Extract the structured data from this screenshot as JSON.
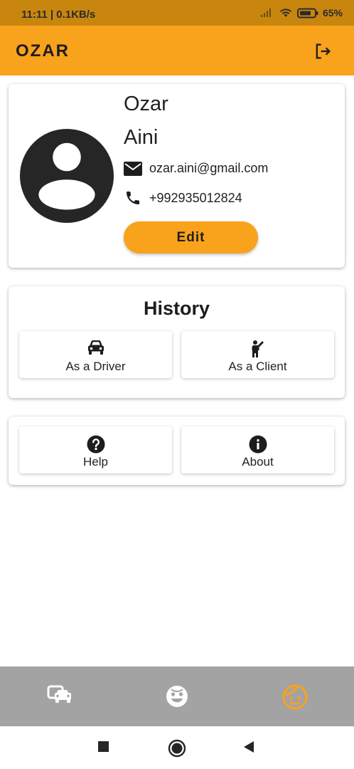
{
  "status_bar": {
    "time_speed": "11:11 | 0.1KB/s",
    "battery": "65%"
  },
  "app_bar": {
    "title": "OZAR",
    "logout_icon": "logout-icon"
  },
  "profile": {
    "first_name": "Ozar",
    "last_name": "Aini",
    "email": "ozar.aini@gmail.com",
    "phone": "+992935012824",
    "edit_label": "Edit",
    "avatar_icon": "account-circle-icon"
  },
  "history": {
    "title": "History",
    "driver_label": "As a Driver",
    "client_label": "As a Client",
    "driver_icon": "car-icon",
    "client_icon": "person-waving-icon"
  },
  "misc": {
    "help_label": "Help",
    "about_label": "About",
    "help_icon": "help-circle-icon",
    "about_icon": "info-icon"
  },
  "bottom_nav": {
    "items": [
      {
        "icon": "cars-icon",
        "active": false
      },
      {
        "icon": "face-icon",
        "active": false
      },
      {
        "icon": "child-face-icon",
        "active": true
      }
    ]
  },
  "colors": {
    "accent": "#f9a21b",
    "status_bar": "#c8860f",
    "bottom_nav": "#a3a3a3",
    "text": "#212121"
  }
}
